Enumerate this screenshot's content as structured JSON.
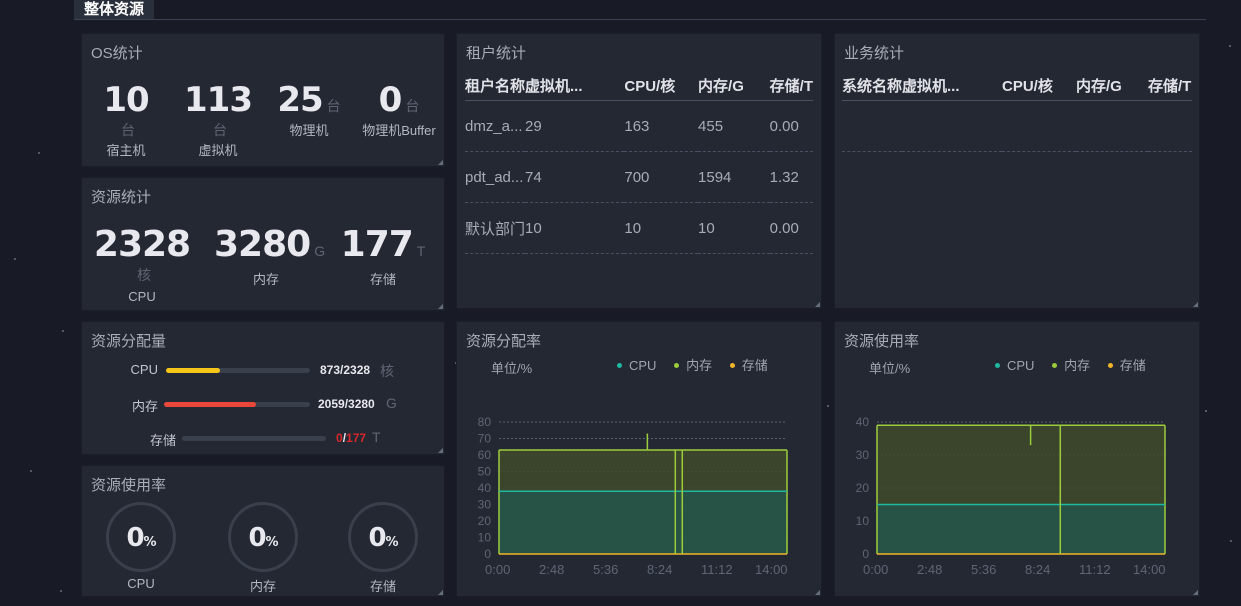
{
  "header": {
    "title": "整体资源"
  },
  "os_stats": {
    "title": "OS统计",
    "items": [
      {
        "value": "10",
        "unit": "台",
        "label": "宿主机"
      },
      {
        "value": "113",
        "unit": "台",
        "label": "虚拟机"
      },
      {
        "value": "25",
        "unit": "台",
        "label": "物理机"
      },
      {
        "value": "0",
        "unit": "台",
        "label": "物理机Buffer"
      }
    ]
  },
  "resource_stats": {
    "title": "资源统计",
    "items": [
      {
        "value": "2328",
        "unit": "核",
        "label": "CPU"
      },
      {
        "value": "3280",
        "unit": "G",
        "label": "内存"
      },
      {
        "value": "177",
        "unit": "T",
        "label": "存储"
      }
    ]
  },
  "allocation": {
    "title": "资源分配量",
    "rows": [
      {
        "label": "CPU",
        "value": "873/2328",
        "unit": "核",
        "fraction": 0.375,
        "color": "#f5c518"
      },
      {
        "label": "内存",
        "value": "2059/3280",
        "unit": "G",
        "fraction": 0.628,
        "color": "#e8473a"
      },
      {
        "label": "存储",
        "value_used": "0",
        "value_sep": "/",
        "value_total": "177",
        "unit": "T",
        "fraction": 0.0,
        "color": "#d6272c"
      }
    ]
  },
  "usage_gauges": {
    "title": "资源使用率",
    "items": [
      {
        "value": "0",
        "pct": "%",
        "label": "CPU"
      },
      {
        "value": "0",
        "pct": "%",
        "label": "内存"
      },
      {
        "value": "0",
        "pct": "%",
        "label": "存储"
      }
    ]
  },
  "tenant_stats": {
    "title": "租户统计",
    "columns": [
      "租户名称",
      "虚拟机...",
      "CPU/核",
      "内存/G",
      "存储/T"
    ],
    "rows": [
      [
        "dmz_a...",
        "29",
        "163",
        "455",
        "0.00"
      ],
      [
        "pdt_ad...",
        "74",
        "700",
        "1594",
        "1.32"
      ],
      [
        "默认部门",
        "10",
        "10",
        "10",
        "0.00"
      ]
    ]
  },
  "business_stats": {
    "title": "业务统计",
    "columns": [
      "系统名称",
      "虚拟机...",
      "CPU/核",
      "内存/G",
      "存储/T"
    ],
    "rows": []
  },
  "chart_data": [
    {
      "type": "area",
      "title": "资源分配率",
      "ylabel": "单位/%",
      "ylim": [
        0,
        80
      ],
      "yticks": [
        0,
        10,
        20,
        30,
        40,
        50,
        60,
        70,
        80
      ],
      "xticks": [
        "0:00",
        "2:48",
        "5:36",
        "8:24",
        "11:12",
        "14:00"
      ],
      "legend": [
        "CPU",
        "内存",
        "存储"
      ],
      "colors": {
        "CPU": "#1fb8a0",
        "内存": "#9ccc3c",
        "存储": "#f0b429"
      },
      "series": [
        {
          "name": "CPU",
          "x": [
            0,
            16.5
          ],
          "values": [
            38,
            38
          ]
        },
        {
          "name": "内存",
          "x": [
            0,
            16.5
          ],
          "values": [
            63,
            63
          ]
        },
        {
          "name": "存储",
          "x": [
            0,
            16.5
          ],
          "values": [
            0,
            0
          ]
        }
      ],
      "spikes": [
        {
          "x": 8.5,
          "value": 73
        },
        {
          "x": 10.1,
          "value": 0
        },
        {
          "x": 10.5,
          "value": 0
        }
      ]
    },
    {
      "type": "area",
      "title": "资源使用率",
      "ylabel": "单位/%",
      "ylim": [
        0,
        40
      ],
      "yticks": [
        0,
        10,
        20,
        30,
        40
      ],
      "xticks": [
        "0:00",
        "2:48",
        "5:36",
        "8:24",
        "11:12",
        "14:00"
      ],
      "legend": [
        "CPU",
        "内存",
        "存储"
      ],
      "colors": {
        "CPU": "#1fb8a0",
        "内存": "#9ccc3c",
        "存储": "#f0b429"
      },
      "series": [
        {
          "name": "CPU",
          "x": [
            0,
            16.5
          ],
          "values": [
            15,
            15
          ]
        },
        {
          "name": "内存",
          "x": [
            0,
            16.5
          ],
          "values": [
            39,
            39
          ]
        },
        {
          "name": "存储",
          "x": [
            0,
            16.5
          ],
          "values": [
            0,
            0
          ]
        }
      ],
      "spikes": [
        {
          "x": 8.8,
          "value": 33
        },
        {
          "x": 10.5,
          "value": 0
        }
      ]
    }
  ]
}
